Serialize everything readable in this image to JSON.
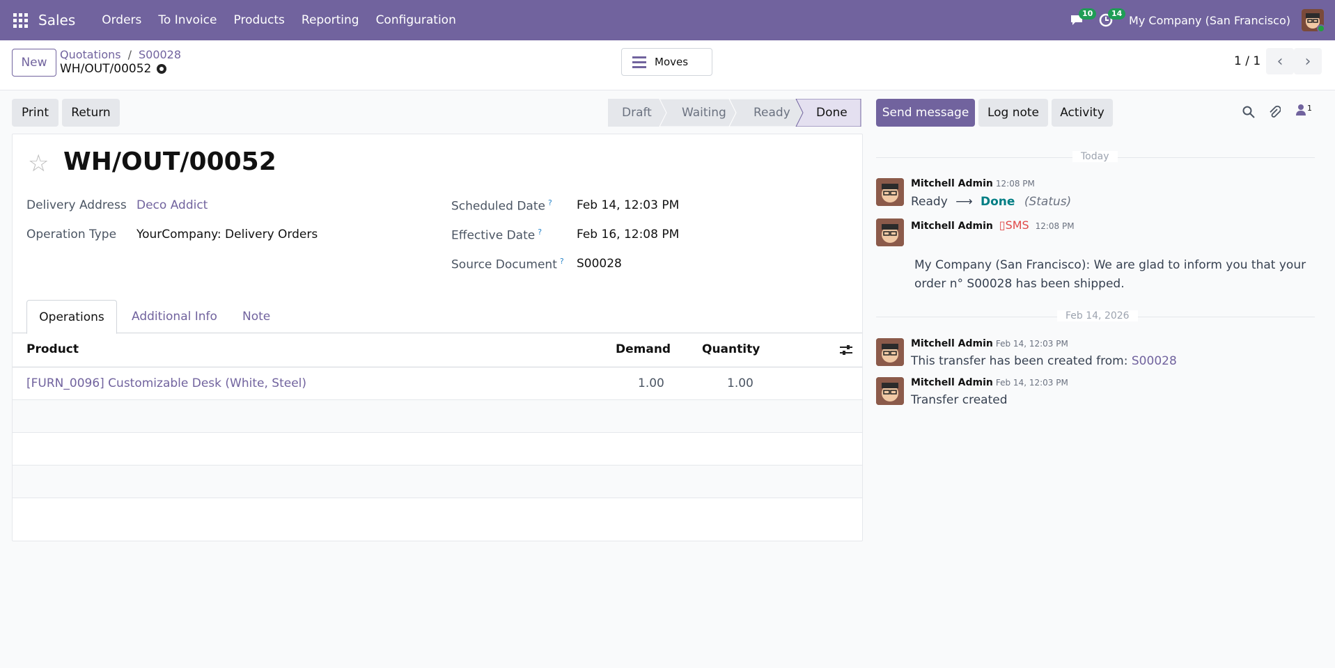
{
  "navbar": {
    "brand": "Sales",
    "menu": [
      "Orders",
      "To Invoice",
      "Products",
      "Reporting",
      "Configuration"
    ],
    "messages_count": "10",
    "activities_count": "14",
    "company": "My Company (San Francisco)"
  },
  "control": {
    "new_label": "New",
    "breadcrumb": [
      "Quotations",
      "S00028"
    ],
    "record_name": "WH/OUT/00052",
    "moves_label": "Moves",
    "pager": "1 / 1"
  },
  "actions": {
    "print": "Print",
    "return": "Return"
  },
  "statusbar": [
    "Draft",
    "Waiting",
    "Ready",
    "Done"
  ],
  "form": {
    "title": "WH/OUT/00052",
    "delivery_address_label": "Delivery Address",
    "delivery_address": "Deco Addict",
    "operation_type_label": "Operation Type",
    "operation_type": "YourCompany: Delivery Orders",
    "scheduled_date_label": "Scheduled Date",
    "scheduled_date": "Feb 14, 12:03 PM",
    "effective_date_label": "Effective Date",
    "effective_date": "Feb 16, 12:08 PM",
    "source_document_label": "Source Document",
    "source_document": "S00028",
    "help_mark": "?",
    "tabs": [
      "Operations",
      "Additional Info",
      "Note"
    ],
    "columns": [
      "Product",
      "Demand",
      "Quantity"
    ],
    "lines": [
      {
        "product": "[FURN_0096] Customizable Desk (White, Steel)",
        "demand": "1.00",
        "quantity": "1.00"
      }
    ]
  },
  "chatter": {
    "send_message": "Send message",
    "log_note": "Log note",
    "activity": "Activity",
    "followers_count": "1",
    "today_label": "Today",
    "date_label": "Feb 14, 2026",
    "messages": [
      {
        "author": "Mitchell Admin",
        "time": "12:08 PM",
        "from": "Ready",
        "arrow": "⟶",
        "to": "Done",
        "field": "(Status)"
      },
      {
        "author": "Mitchell Admin",
        "sms": "SMS",
        "time": "12:08 PM",
        "body": "My Company (San Francisco): We are glad to inform you that your order n° S00028 has been shipped."
      },
      {
        "author": "Mitchell Admin",
        "time": "Feb 14, 12:03 PM",
        "body": "This transfer has been created from:",
        "link": "S00028"
      },
      {
        "author": "Mitchell Admin",
        "time": "Feb 14, 12:03 PM",
        "body": "Transfer created"
      }
    ]
  },
  "colors": {
    "brand": "#71639e",
    "badge": "#1f9d55",
    "status_done_bg": "#e4e0f0",
    "sms_red": "#e04848",
    "teal": "#017e84"
  }
}
